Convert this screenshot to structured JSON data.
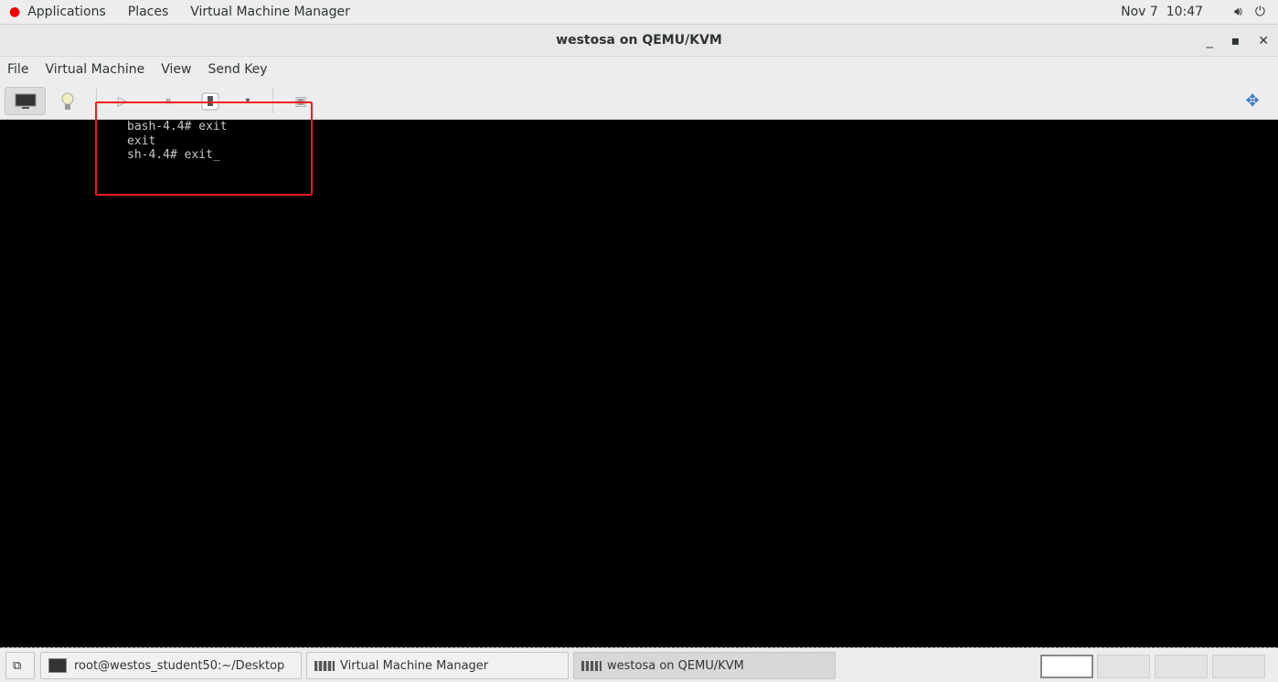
{
  "topbar": {
    "applications": "Applications",
    "places": "Places",
    "app": "Virtual Machine Manager",
    "date": "Nov 7",
    "time": "10:47"
  },
  "window": {
    "title": "westosa on QEMU/KVM",
    "minimize": "_",
    "maximize": "▪",
    "close": "✕"
  },
  "menu": [
    "File",
    "Virtual Machine",
    "View",
    "Send Key"
  ],
  "console": {
    "lines": [
      "bash-4.4# exit",
      "exit",
      "sh-4.4# exit_"
    ]
  },
  "taskbar": {
    "tasks": [
      {
        "label": "root@westos_student50:~/Desktop",
        "active": false
      },
      {
        "label": "Virtual Machine Manager",
        "active": false
      },
      {
        "label": "westosa on QEMU/KVM",
        "active": true
      }
    ]
  },
  "colors": {
    "highlight": "#f21c1c"
  }
}
